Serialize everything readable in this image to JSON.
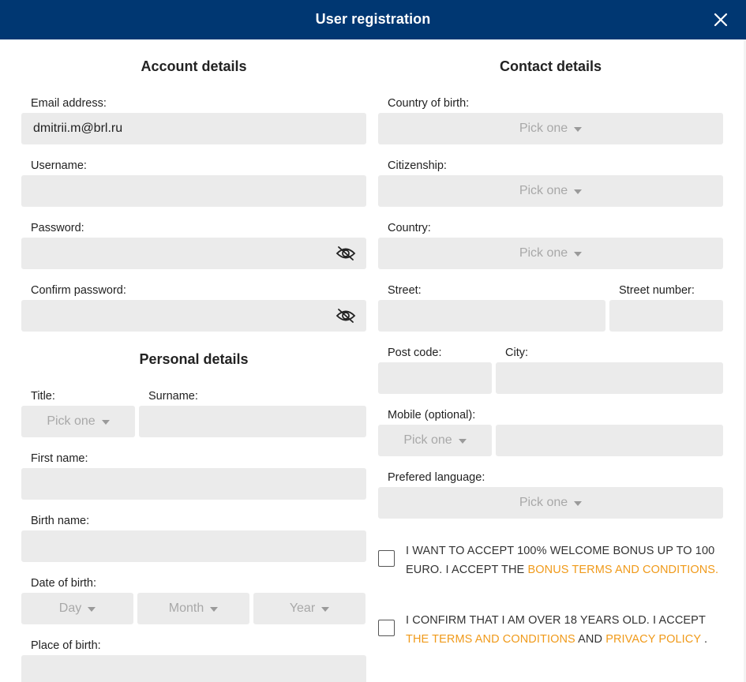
{
  "modal": {
    "title": "User registration",
    "close_icon": "close-icon",
    "header_color": "#003772"
  },
  "account": {
    "heading": "Account details",
    "email_label": "Email address:",
    "email_value": "dmitrii.m@brl.ru",
    "username_label": "Username:",
    "username_value": "",
    "password_label": "Password:",
    "confirm_password_label": "Confirm password:",
    "eye_icon": "eye-slash-icon"
  },
  "personal": {
    "heading": "Personal details",
    "title_label": "Title:",
    "title_placeholder": "Pick one",
    "surname_label": "Surname:",
    "first_name_label": "First name:",
    "birth_name_label": "Birth name:",
    "dob_label": "Date of birth:",
    "day_placeholder": "Day",
    "month_placeholder": "Month",
    "year_placeholder": "Year",
    "place_of_birth_label": "Place of birth:"
  },
  "contact": {
    "heading": "Contact details",
    "country_of_birth_label": "Country of birth:",
    "citizenship_label": "Citizenship:",
    "country_label": "Country:",
    "pick_one": "Pick one",
    "street_label": "Street:",
    "street_number_label": "Street number:",
    "post_code_label": "Post code:",
    "city_label": "City:",
    "mobile_label": "Mobile (optional):",
    "language_label": "Prefered language:"
  },
  "consents": {
    "bonus_text": "I want to accept 100% welcome bonus up to 100 euro. I accept the ",
    "bonus_link": "bonus terms and conditions.",
    "age_text": "I confirm that I am over 18 years old. I accept ",
    "terms_link": "the terms and conditions",
    "and_text": " and ",
    "privacy_link": "privacy policy",
    "end_text": " .",
    "link_color": "#f09a1a"
  }
}
